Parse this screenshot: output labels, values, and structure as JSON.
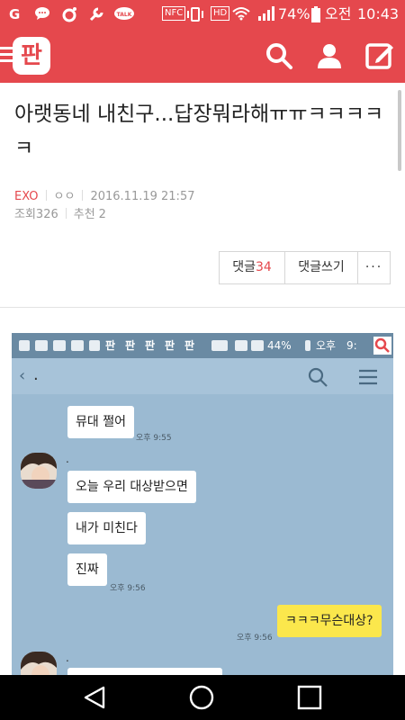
{
  "status_bar": {
    "left_icons": [
      "ollehtv-icon",
      "chat-icon",
      "record-icon",
      "wrench-icon",
      "talk-icon"
    ],
    "nfc_label": "NFC",
    "hd_label": "HD",
    "battery": "74%",
    "ampm": "오전",
    "time": "10:43"
  },
  "header": {
    "logo": "판",
    "icons": [
      "search-icon",
      "user-icon",
      "write-icon"
    ]
  },
  "post": {
    "title": "아랫동네 내친구...답장뭐라해ㅠㅠㅋㅋㅋㅋㅋ",
    "category": "EXO",
    "author": "ㅇㅇ",
    "date": "2016.11.19 21:57",
    "views_label": "조회",
    "views": "326",
    "recommend_label": "추천",
    "recommend": "2"
  },
  "actions": {
    "comments_label": "댓글",
    "comments_count": "34",
    "write_comment": "댓글쓰기",
    "more": "···"
  },
  "screenshot": {
    "status": {
      "battery": "44%",
      "ampm": "오후",
      "time": "9:",
      "app_icons": [
        "판",
        "판",
        "판",
        "판",
        "판"
      ]
    },
    "room_name": ".",
    "messages": [
      {
        "text": "뮤대 쩔어",
        "time": "오후 9:55"
      },
      {
        "sender": ".",
        "text": "오늘 우리 대상받으면"
      },
      {
        "text": "내가 미친다"
      },
      {
        "text": "진짜",
        "time": "오후 9:56"
      },
      {
        "mine": true,
        "text": "ㅋㅋㅋ무슨대상?",
        "time": "오후 9:56"
      },
      {
        "sender": "."
      }
    ]
  },
  "colors": {
    "brand": "#e5484d",
    "chat_bg": "#9bbad2",
    "my_bubble": "#fbe74c"
  }
}
